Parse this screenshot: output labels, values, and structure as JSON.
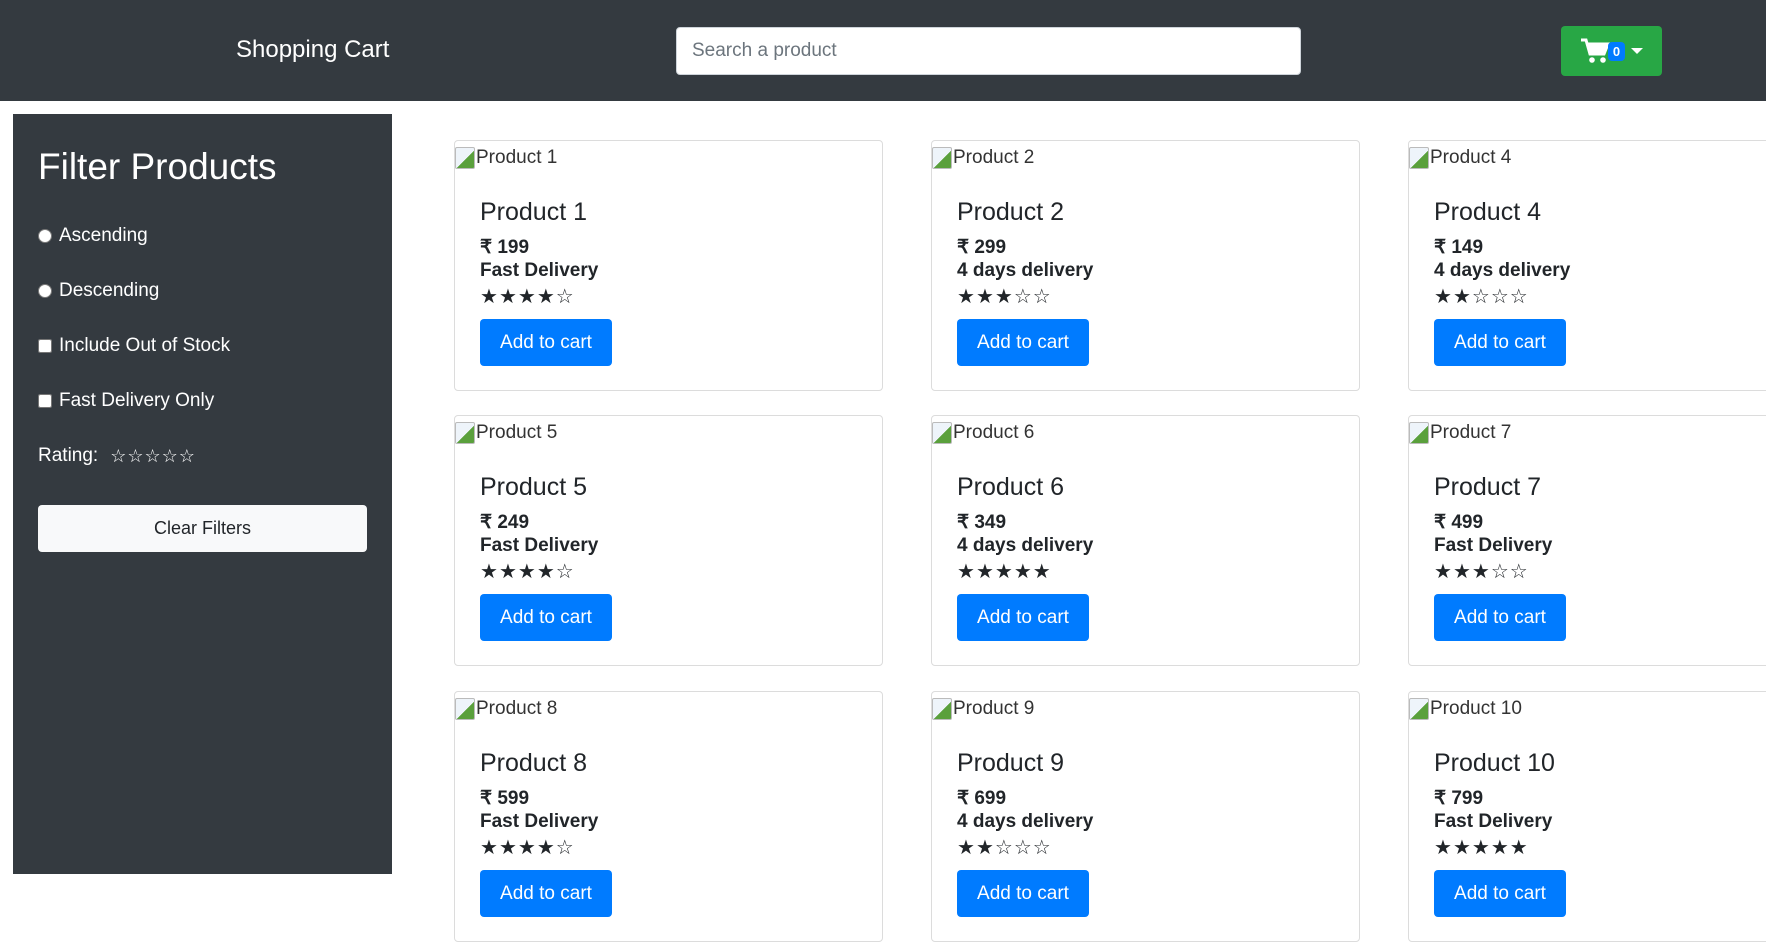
{
  "header": {
    "title": "Shopping Cart",
    "search_placeholder": "Search a product",
    "cart_count": "0",
    "cart_color": "#28a745"
  },
  "sidebar": {
    "title": "Filter Products",
    "options": [
      {
        "type": "radio",
        "label": "Ascending"
      },
      {
        "type": "radio",
        "label": "Descending"
      },
      {
        "type": "checkbox",
        "label": "Include Out of Stock"
      },
      {
        "type": "checkbox",
        "label": "Fast Delivery Only"
      }
    ],
    "rating_label": "Rating:",
    "rating_value": 0,
    "clear_label": "Clear Filters"
  },
  "products": [
    {
      "name": "Product 1",
      "price": "₹ 199",
      "delivery": "Fast Delivery",
      "rating": 4
    },
    {
      "name": "Product 2",
      "price": "₹ 299",
      "delivery": "4 days delivery",
      "rating": 3
    },
    {
      "name": "Product 4",
      "price": "₹ 149",
      "delivery": "4 days delivery",
      "rating": 2
    },
    {
      "name": "Product 5",
      "price": "₹ 249",
      "delivery": "Fast Delivery",
      "rating": 4
    },
    {
      "name": "Product 6",
      "price": "₹ 349",
      "delivery": "4 days delivery",
      "rating": 5
    },
    {
      "name": "Product 7",
      "price": "₹ 499",
      "delivery": "Fast Delivery",
      "rating": 3
    },
    {
      "name": "Product 8",
      "price": "₹ 599",
      "delivery": "Fast Delivery",
      "rating": 4
    },
    {
      "name": "Product 9",
      "price": "₹ 699",
      "delivery": "4 days delivery",
      "rating": 2
    },
    {
      "name": "Product 10",
      "price": "₹ 799",
      "delivery": "Fast Delivery",
      "rating": 5
    }
  ],
  "add_to_cart_label": "Add to cart",
  "accent_color": "#007bff"
}
